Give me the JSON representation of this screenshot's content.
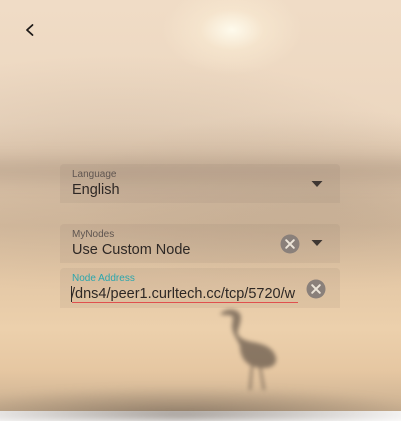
{
  "nav": {
    "back_icon": "chevron-left-icon"
  },
  "language": {
    "label": "Language",
    "value": "English",
    "icon": "dropdown-arrow-icon"
  },
  "mynodes": {
    "label": "MyNodes",
    "value": "Use Custom Node",
    "clear_icon": "clear-circle-icon",
    "icon": "dropdown-arrow-icon"
  },
  "node_address": {
    "label": "Node Address",
    "value": "/dns4/peer1.curltech.cc/tcp/5720/w",
    "clear_icon": "clear-circle-icon"
  },
  "colors": {
    "accent_label": "#2aa6ad",
    "error_underline": "#e0504e",
    "field_background": "rgba(125,112,100,0.10)",
    "icon_gray": "#8a807a"
  }
}
